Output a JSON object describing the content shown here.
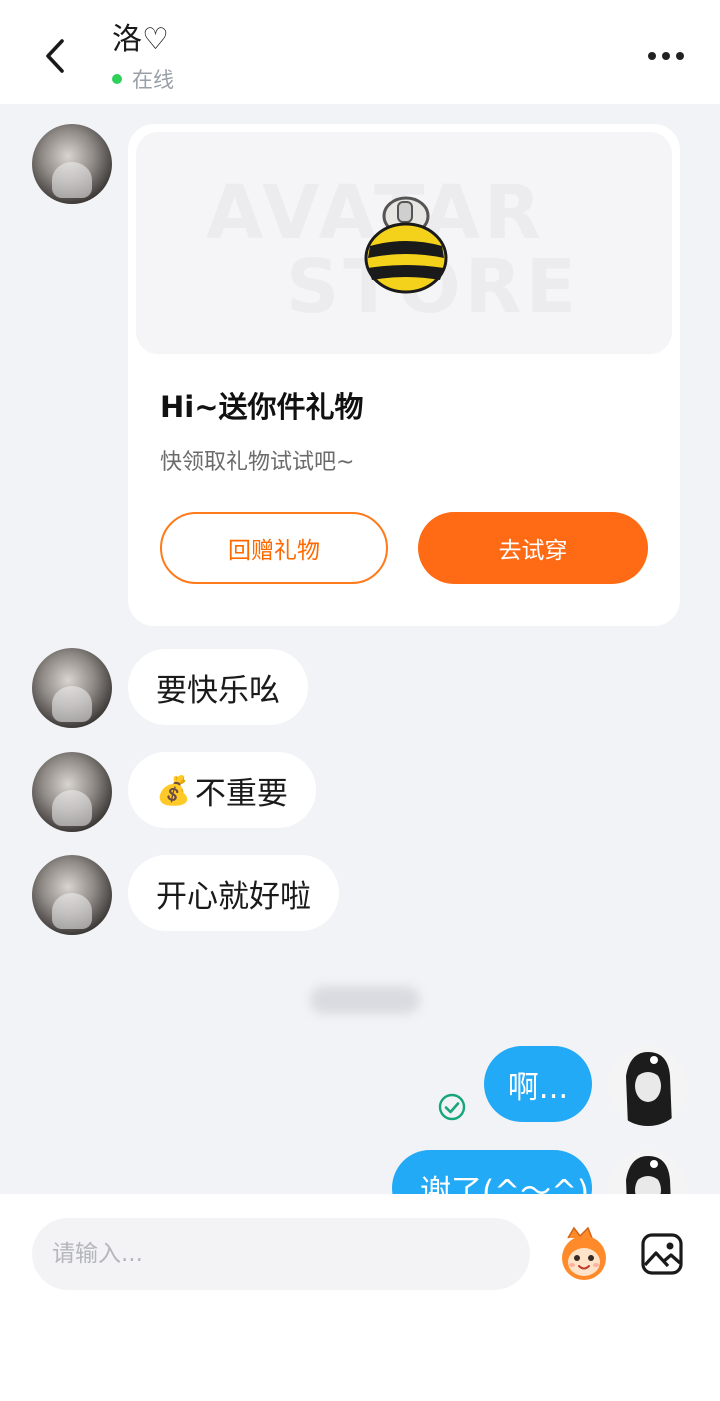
{
  "header": {
    "title": "洛♡",
    "status": "在线",
    "back_icon": "chevron-left-icon",
    "more_icon": "more-horizontal-icon"
  },
  "gift_card": {
    "banner_text_1": "AVATAR",
    "banner_text_2": "STORE",
    "title": "Hi~送你件礼物",
    "subtitle": "快领取礼物试试吧~",
    "return_button": "回赠礼物",
    "try_button": "去试穿",
    "accent_color": "#ff6a14"
  },
  "messages_in": [
    {
      "text": "要快乐吆"
    },
    {
      "emoji": "💰",
      "text": "不重要"
    },
    {
      "text": "开心就好啦"
    }
  ],
  "messages_out": [
    {
      "text": "啊..."
    },
    {
      "text": "谢了(^～^)"
    }
  ],
  "input": {
    "placeholder": "请输入..."
  },
  "colors": {
    "out_bubble": "#22aaf6",
    "online_dot": "#2fd05a",
    "read_check": "#17a67a"
  }
}
